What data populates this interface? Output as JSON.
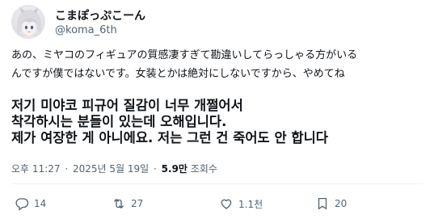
{
  "user": {
    "display_name": "こまぽっぷこーん",
    "handle": "@koma_6th"
  },
  "tweet": {
    "jp_lines": [
      "あの、ミヤコのフィギュアの質感凄すぎて勘違いしてらっしゃる方がいる",
      "んですが僕ではないです。女装とかは絶対にしないですから、やめてね"
    ],
    "kr_lines": [
      "저기 미야코 피규어 질감이 너무 개쩔어서",
      "착각하시는 분들이 있는데 오해입니다.",
      "제가 여장한 게 아니에요. 저는 그런 건 죽어도 안 합니다"
    ]
  },
  "meta": {
    "time": "오후 11:27",
    "separator": "·",
    "date": "2025년 5월 19일",
    "views_count": "5.9만",
    "views_label": "조회수"
  },
  "actions": {
    "reply_count": "14",
    "retweet_count": "27",
    "like_count": "1.1천",
    "views_count": "20"
  },
  "colors": {
    "text": "#0f1419",
    "secondary": "#536471",
    "divider": "#eff3f4"
  }
}
